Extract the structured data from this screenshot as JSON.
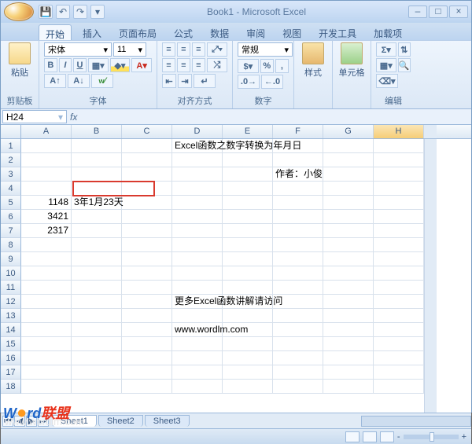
{
  "titlebar": {
    "title": "Book1 - Microsoft Excel"
  },
  "tabs": [
    "开始",
    "插入",
    "页面布局",
    "公式",
    "数据",
    "审阅",
    "视图",
    "开发工具",
    "加载项"
  ],
  "ribbon": {
    "clipboard": {
      "paste": "粘贴",
      "label": "剪贴板"
    },
    "font": {
      "name": "宋体",
      "size": "11",
      "label": "字体"
    },
    "alignment": {
      "label": "对齐方式"
    },
    "number": {
      "format": "常规",
      "label": "数字"
    },
    "styles": {
      "btn": "样式",
      "label": ""
    },
    "cells": {
      "btn": "单元格",
      "label": ""
    },
    "editing": {
      "label": "编辑"
    }
  },
  "namebox": "H24",
  "columns": [
    "A",
    "B",
    "C",
    "D",
    "E",
    "F",
    "G",
    "H"
  ],
  "rowcount": 18,
  "cells": {
    "D1": "Excel函数之数字转换为年月日",
    "F3": "作者：小俊",
    "A5": "1148",
    "B5": "3年1月23天",
    "A6": "3421",
    "A7": "2317",
    "D12": "更多Excel函数讲解请访问",
    "D14": "www.wordlm.com"
  },
  "sheets": [
    "Sheet1",
    "Sheet2",
    "Sheet3"
  ],
  "status": {
    "zoom_minus": "-",
    "zoom_plus": "+"
  },
  "watermark": {
    "brand1": "W",
    "brand_mid": "rd",
    "brand2": "联盟",
    "url": "www.wordlm.com"
  }
}
